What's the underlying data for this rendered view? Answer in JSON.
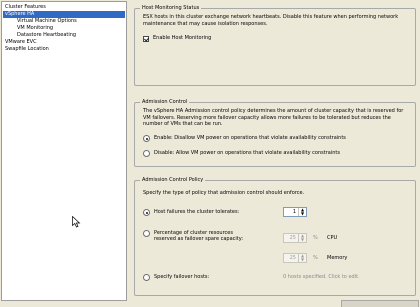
{
  "sidebar": {
    "items": [
      {
        "label": "Cluster Features"
      },
      {
        "label": "vSphere HA"
      },
      {
        "label": "Virtual Machine Options"
      },
      {
        "label": "VM Monitoring"
      },
      {
        "label": "Datastore Heartbeating"
      },
      {
        "label": "VMware EVC"
      },
      {
        "label": "Swapfile Location"
      }
    ]
  },
  "host_monitoring": {
    "title": "Host Monitoring Status",
    "desc": "ESX hosts in this cluster exchange network heartbeats. Disable this feature when performing network maintenance that may cause isolation responses.",
    "checkbox_label": "Enable Host Monitoring",
    "checked": true
  },
  "admission_control": {
    "title": "Admission Control",
    "desc": "The vSphere HA Admission control policy determines the amount of cluster capacity that is reserved for VM failovers. Reserving more failover capacity allows more failures to be tolerated but reduces the number of VMs that can be run.",
    "enable_label": "Enable: Disallow VM power on operations that violate availability constraints",
    "disable_label": "Disable: Allow VM power on operations that violate availability constraints",
    "selected": "enable"
  },
  "policy": {
    "title": "Admission Control Policy",
    "desc": "Specify the type of policy that admission control should enforce.",
    "host_failures_label": "Host failures the cluster tolerates:",
    "host_failures_value": "1",
    "percentage_label_1": "Percentage of cluster resources",
    "percentage_label_2": "reserved as failover spare capacity:",
    "cpu_value": "25",
    "cpu_unit": "%",
    "cpu_label": "CPU",
    "memory_value": "25",
    "memory_unit": "%",
    "memory_label": "Memory",
    "failover_hosts_label": "Specify failover hosts:",
    "failover_hosts_status": "0 hosts specified. Click to edit.",
    "selected": "host_failures"
  },
  "colors": {
    "selection": "#316ac5",
    "background": "#ece9d8"
  }
}
